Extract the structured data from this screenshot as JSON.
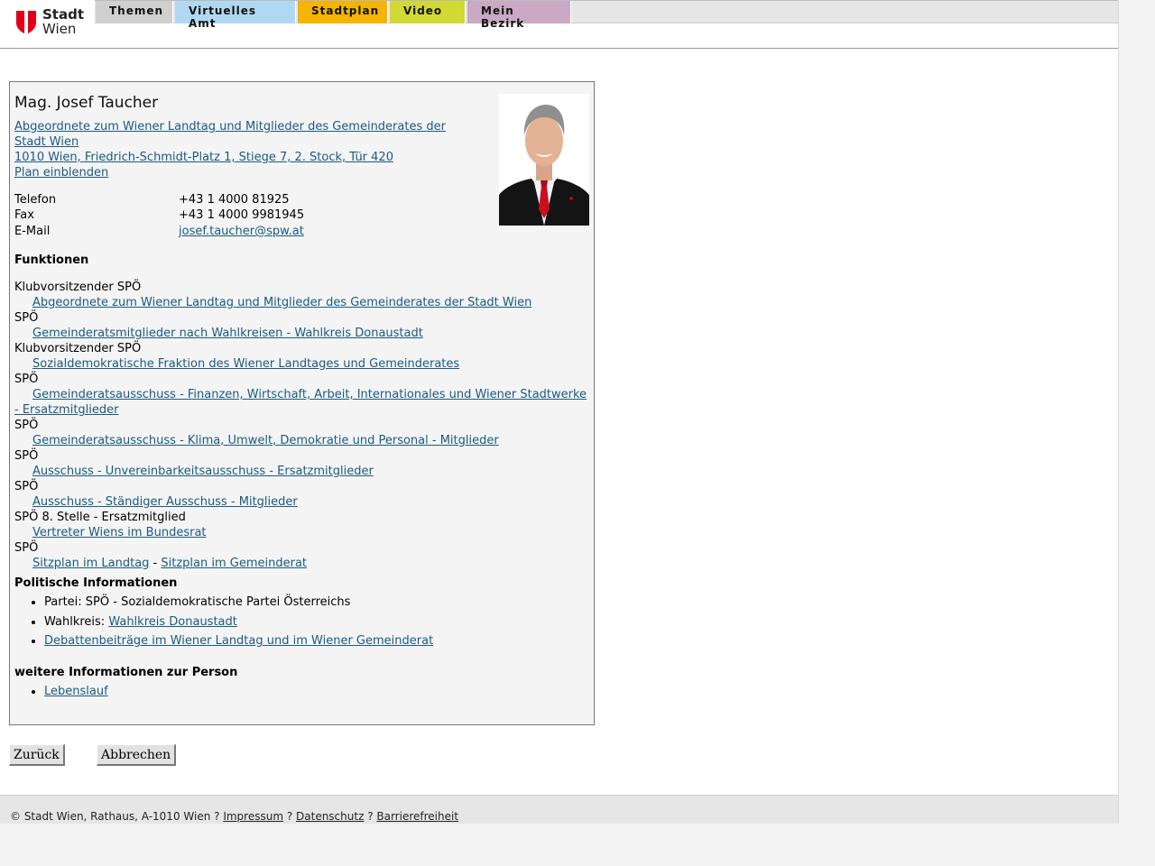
{
  "brand": {
    "line1": "Stadt",
    "line2": "Wien"
  },
  "nav": [
    "Themen",
    "Virtuelles Amt",
    "Stadtplan",
    "Video",
    "Mein Bezirk"
  ],
  "person": {
    "name": "Mag. Josef Taucher",
    "org_line1": "Abgeordnete zum Wiener Landtag und Mitglieder des Gemeinderates der",
    "org_line2": "Stadt Wien ",
    "address": "1010 Wien, Friedrich-Schmidt-Platz 1, Stiege 7, 2. Stock, Tür 420",
    "plan_link": "Plan einblenden"
  },
  "contact": {
    "phone_label": "Telefon",
    "phone": "+43 1 4000 81925",
    "fax_label": "Fax",
    "fax": "+43 1 4000 9981945",
    "email_label": "E-Mail",
    "email": "josef.taucher@spw.at"
  },
  "functions": {
    "heading": "Funktionen",
    "items": [
      {
        "role": "Klubvorsitzender SPÖ",
        "link": "Abgeordnete zum Wiener Landtag und Mitglieder des Gemeinderates der Stadt Wien"
      },
      {
        "role": "SPÖ",
        "link": "Gemeinderatsmitglieder nach Wahlkreisen - Wahlkreis Donaustadt"
      },
      {
        "role": "Klubvorsitzender SPÖ",
        "link": "Sozialdemokratische Fraktion des Wiener Landtages und Gemeinderates"
      },
      {
        "role": "SPÖ",
        "link": "Gemeinderatsausschuss - Finanzen, Wirtschaft, Arbeit, Internationales und Wiener Stadtwerke - Ersatzmitglieder"
      },
      {
        "role": "SPÖ",
        "link": "Gemeinderatsausschuss - Klima, Umwelt, Demokratie und Personal - Mitglieder"
      },
      {
        "role": "SPÖ",
        "link": "Ausschuss - Unvereinbarkeitsausschuss - Ersatzmitglieder"
      },
      {
        "role": "SPÖ",
        "link": "Ausschuss - Ständiger Ausschuss - Mitglieder"
      },
      {
        "role": "SPÖ 8. Stelle - Ersatzmitglied",
        "link": "Vertreter Wiens im Bundesrat"
      }
    ],
    "last_role": "SPÖ",
    "seat_landtag": "Sitzplan im Landtag",
    "seat_sep": " - ",
    "seat_gemeinderat": "Sitzplan im Gemeinderat"
  },
  "political": {
    "heading": "Politische Informationen",
    "party": "Partei: SPÖ - Sozialdemokratische Partei Österreichs",
    "district_label": "Wahlkreis: ",
    "district_link": "Wahlkreis Donaustadt",
    "debates_link": "Debattenbeiträge im Wiener Landtag und im Wiener Gemeinderat"
  },
  "more": {
    "heading": "weitere Informationen zur Person",
    "cv_link": "Lebenslauf"
  },
  "buttons": {
    "back": "Zurück",
    "cancel": "Abbrechen"
  },
  "footer": {
    "copyright": "© Stadt Wien, Rathaus, A-1010 Wien ? ",
    "impressum": "Impressum",
    "sep1": " ? ",
    "privacy": "Datenschutz",
    "sep2": " ? ",
    "accessibility": "Barrierefreiheit"
  },
  "colors": {
    "link": "#1a5a82",
    "card_bg": "#f4f4f4",
    "tab_themen": "#d0d0d0",
    "tab_amt": "#b0d8f2",
    "tab_plan": "#f5b400",
    "tab_video": "#d3d933",
    "tab_bezirk": "#c9a9c4",
    "logo_red": "#e2001a"
  }
}
